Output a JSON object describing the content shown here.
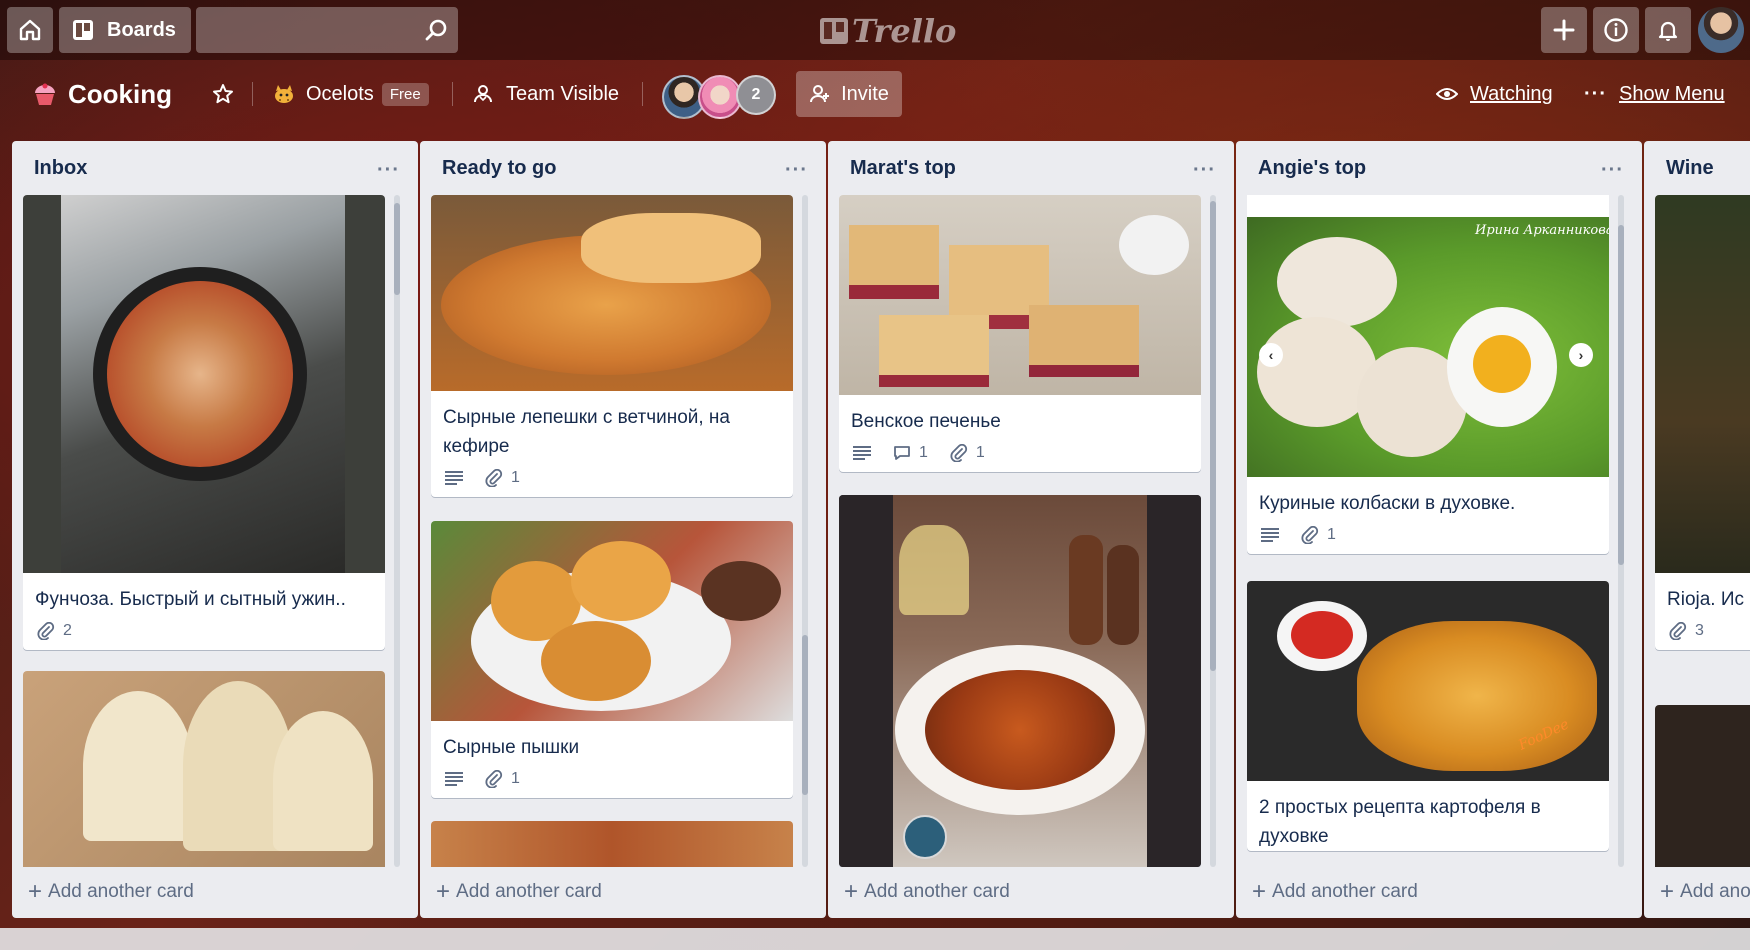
{
  "topbar": {
    "home_icon": "home-icon",
    "boards_label": "Boards",
    "search_value": "",
    "logo_text": "Trello",
    "add_icon": "plus-icon",
    "info_icon": "info-icon",
    "notifications_icon": "bell-icon"
  },
  "board": {
    "title": "Cooking",
    "team_name": "Ocelots",
    "team_plan": "Free",
    "visibility": "Team Visible",
    "extra_members": "2",
    "invite_label": "Invite",
    "watching_label": "Watching",
    "show_menu_label": "Show Menu"
  },
  "colors": {
    "accent": "#0079bf",
    "list_bg": "#ebecf0",
    "card_text": "#172b4d",
    "meta_text": "#5e6c84"
  },
  "lists": [
    {
      "title": "Inbox",
      "add_label": "Add another card",
      "cards": [
        {
          "title": "Фунчоза. Быстрый и сытный ужин..",
          "attachments": "2"
        },
        {
          "title": ""
        }
      ]
    },
    {
      "title": "Ready to go",
      "add_label": "Add another card",
      "cards": [
        {
          "title": "Сырные лепешки с ветчиной, на кефире",
          "attachments": "1"
        },
        {
          "title": "Сырные пышки",
          "attachments": "1"
        },
        {
          "title": ""
        }
      ]
    },
    {
      "title": "Marat's top",
      "add_label": "Add another card",
      "cards": [
        {
          "title": "Венское печенье",
          "comments": "1",
          "attachments": "1"
        },
        {
          "title": ""
        }
      ]
    },
    {
      "title": "Angie's top",
      "add_label": "Add another card",
      "cards": [
        {
          "title": "Куриные колбаски в духовке.",
          "attachments": "1",
          "image_caption": "Ирина Арканникова"
        },
        {
          "title": "2 простых рецепта картофеля в духовке",
          "image_caption": "FooDee"
        }
      ]
    },
    {
      "title": "Wine",
      "add_label": "Add another card",
      "cards": [
        {
          "title": "Rioja. Ис регионa)",
          "attachments": "3"
        },
        {
          "title": ""
        }
      ]
    }
  ]
}
